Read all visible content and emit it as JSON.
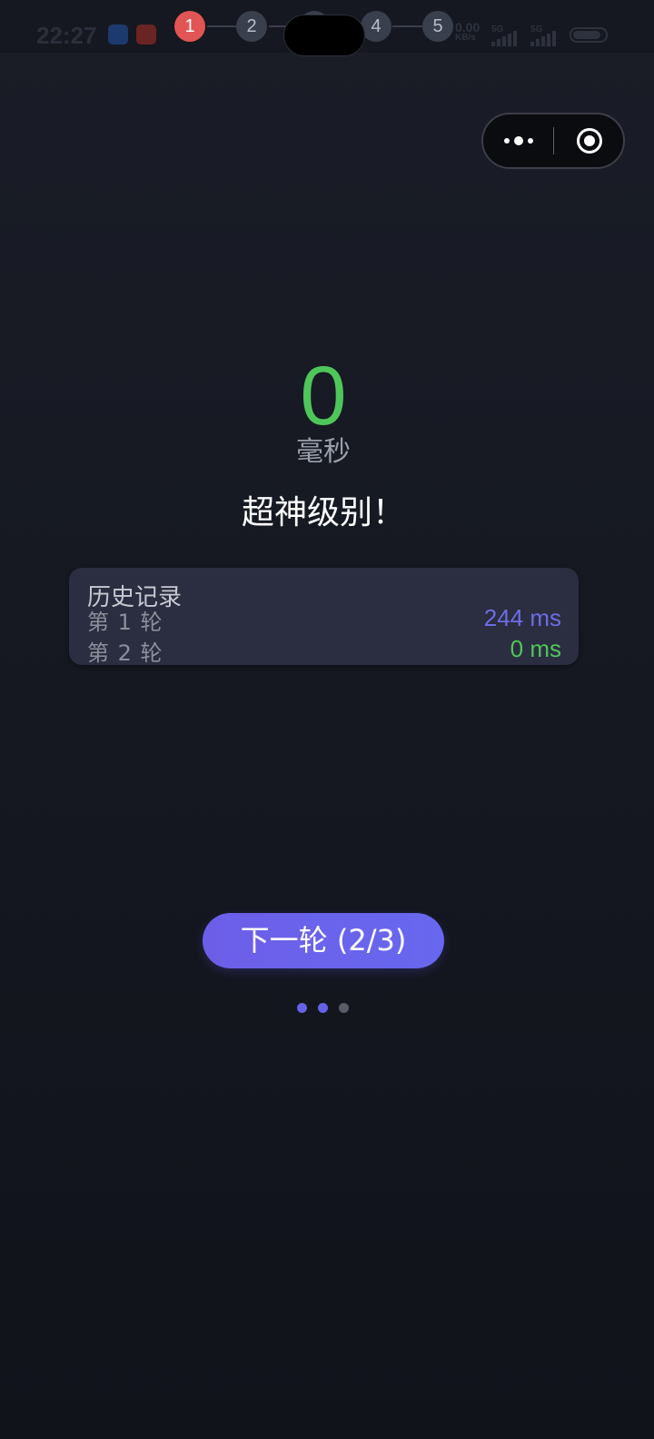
{
  "status_bar": {
    "time": "22:27",
    "net_speed_value": "0.00",
    "net_speed_unit": "KB/s",
    "signal_1_label": "5G",
    "signal_2_label": "5G"
  },
  "steps": [
    "1",
    "2",
    "3",
    "4",
    "5"
  ],
  "active_step": 1,
  "result": {
    "value": "0",
    "unit": "毫秒",
    "rank": "超神级别！",
    "value_color": "#4fc65a"
  },
  "history": {
    "title": "历史记录",
    "rows": [
      {
        "label": "第 1 轮",
        "value": "244 ms",
        "color": "#6c6de6"
      },
      {
        "label": "第 2 轮",
        "value": "0 ms",
        "color": "#4fc65a"
      }
    ]
  },
  "next_button": {
    "label": "下一轮 (2/3)"
  },
  "pager": {
    "colors": [
      "#6562e6",
      "#6562e6",
      "#5a5d68"
    ]
  },
  "capsule": {
    "more_icon": "more-dots-icon",
    "close_icon": "target-circle-icon"
  }
}
